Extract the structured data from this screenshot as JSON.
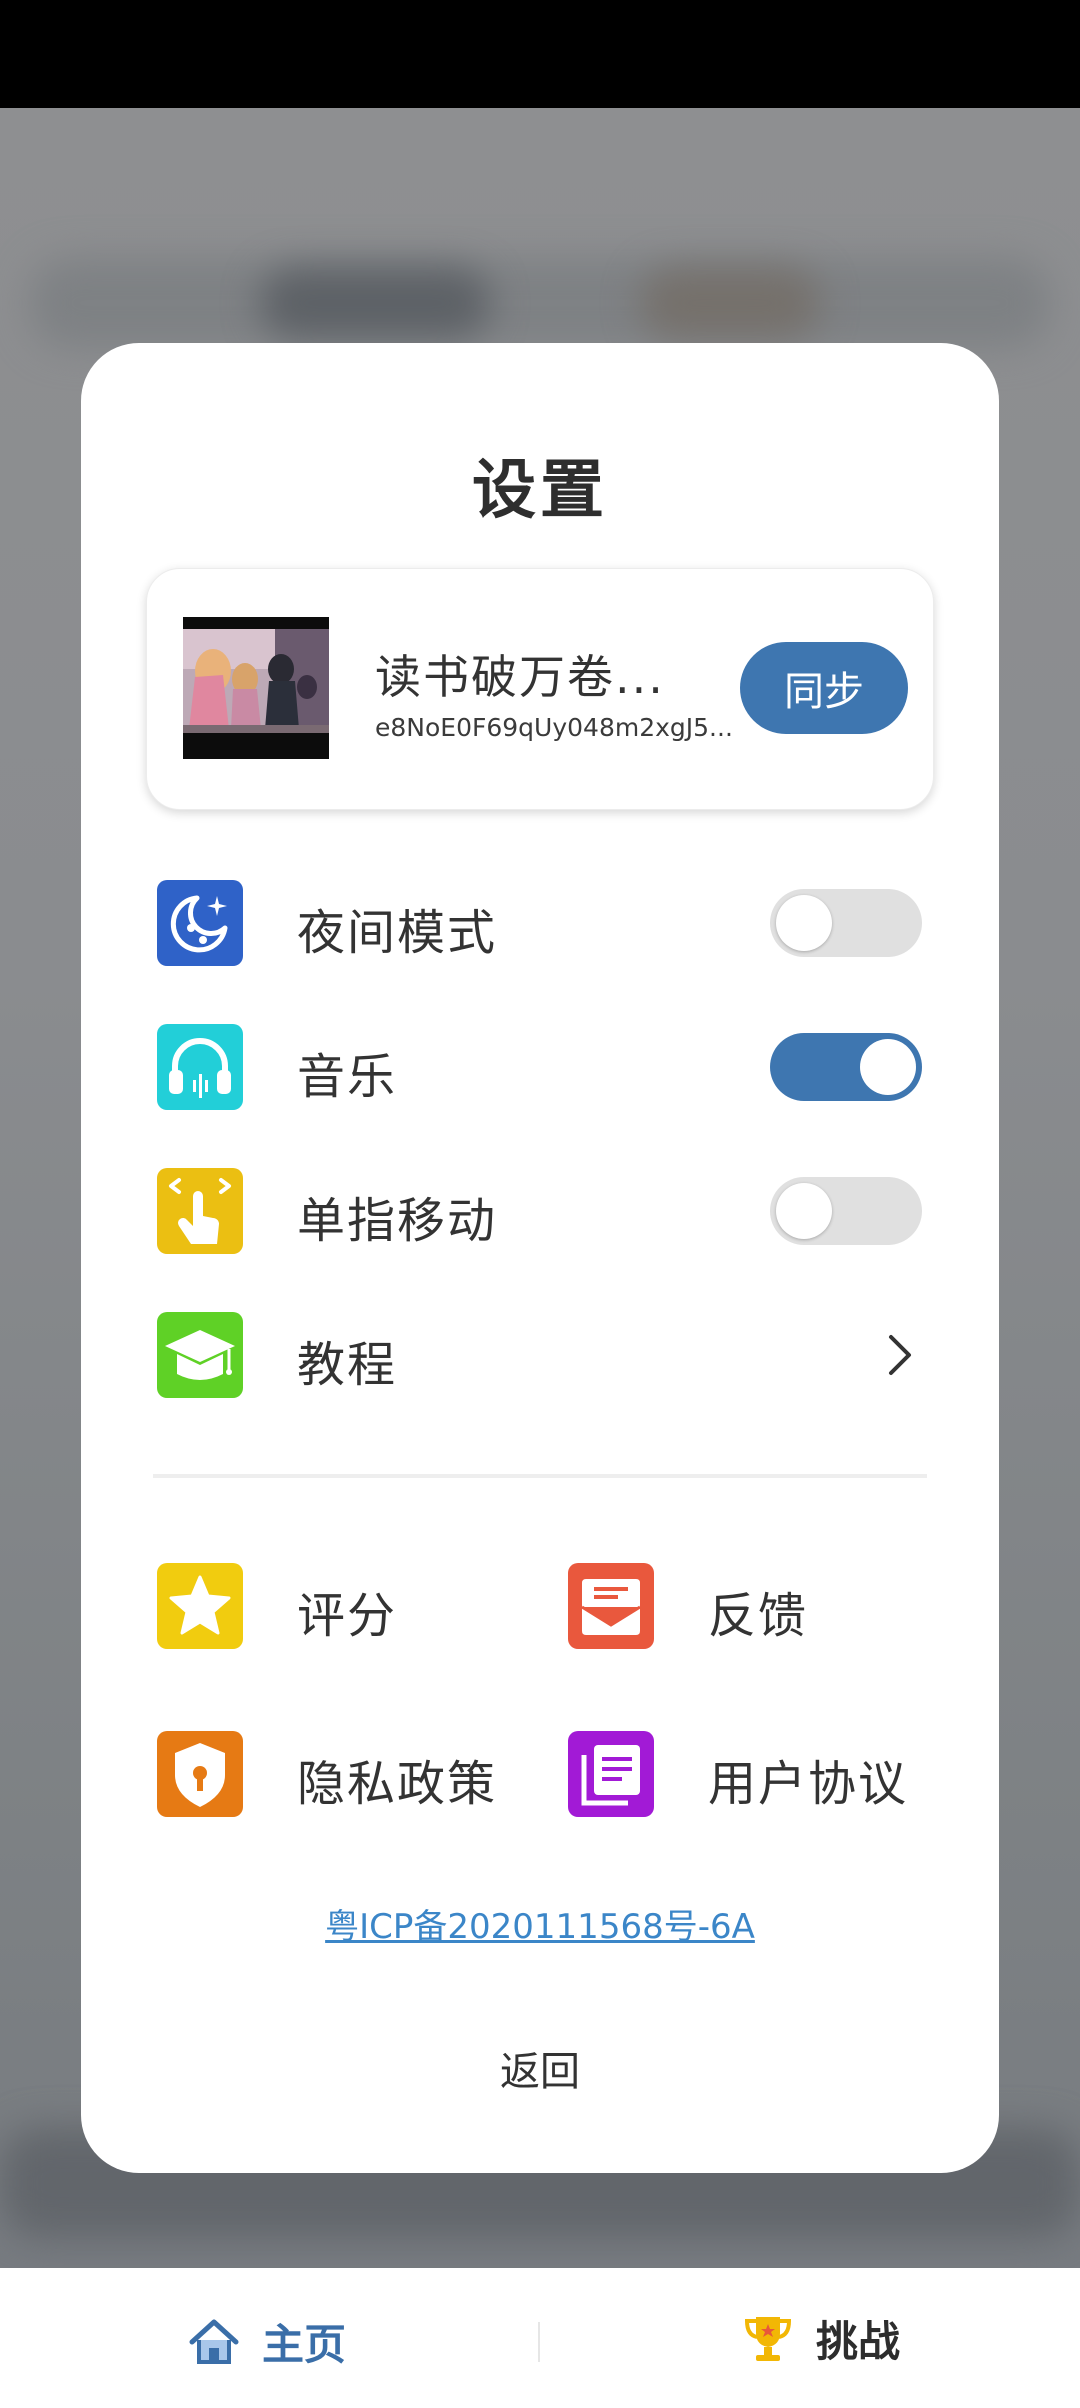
{
  "dialog": {
    "title": "设置",
    "profile": {
      "name": "读书破万卷...",
      "user_id": "e8NoE0F69qUy048m2xgJ5...",
      "sync_label": "同步"
    },
    "settings": [
      {
        "key": "night_mode",
        "label": "夜间模式",
        "icon": "moon-stars-icon",
        "icon_color": "#2f62c8",
        "type": "toggle",
        "enabled": false
      },
      {
        "key": "music",
        "label": "音乐",
        "icon": "headphones-icon",
        "icon_color": "#22cfd8",
        "type": "toggle",
        "enabled": true
      },
      {
        "key": "single_finger",
        "label": "单指移动",
        "icon": "swipe-hand-icon",
        "icon_color": "#ebbf12",
        "type": "toggle",
        "enabled": false
      },
      {
        "key": "tutorial",
        "label": "教程",
        "icon": "graduation-cap-icon",
        "icon_color": "#5fd126",
        "type": "link"
      }
    ],
    "grid": [
      {
        "label": "评分",
        "icon": "star-icon",
        "icon_color": "#f1cc0f"
      },
      {
        "label": "反馈",
        "icon": "envelope-chat-icon",
        "icon_color": "#e9583d"
      },
      {
        "label": "隐私政策",
        "icon": "shield-lock-icon",
        "icon_color": "#e67a14"
      },
      {
        "label": "用户协议",
        "icon": "document-list-icon",
        "icon_color": "#a21ad6"
      }
    ],
    "icp_text": "粤ICP备2020111568号-6A",
    "back_label": "返回"
  },
  "bottom_nav": {
    "home_label": "主页",
    "challenge_label": "挑战"
  },
  "colors": {
    "accent": "#3e76b0",
    "link": "#3b86c8"
  }
}
